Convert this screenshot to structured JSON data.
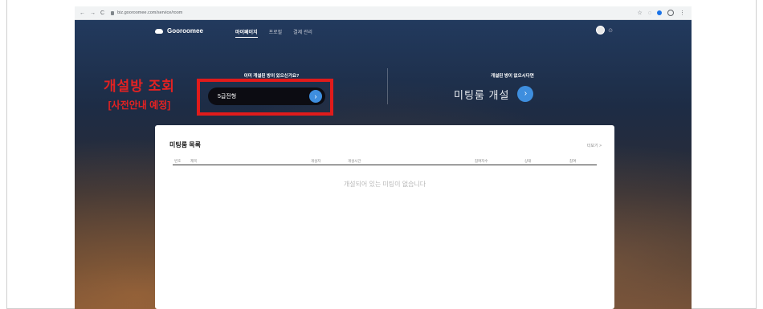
{
  "browser": {
    "nav": [
      "←",
      "→",
      "C"
    ],
    "url": "biz.gooroomee.com/service/room",
    "icons": [
      "star-icon",
      "extension-icon",
      "profile-icon",
      "menu-icon"
    ]
  },
  "header": {
    "brand": "Gooroomee",
    "menu": [
      "마이페이지",
      "프로필",
      "결제 관리"
    ]
  },
  "hero": {
    "left_question": "이미 개설된 방이 있으신가요?",
    "search_value": "5급전형",
    "right_question": "개설된 방이 없으시다면",
    "create_label": "미팅룸 개설"
  },
  "annotation": {
    "line1": "개설방 조회",
    "line2": "[사전안내 예정]"
  },
  "card": {
    "title": "미팅룸 목록",
    "more": "더보기 >",
    "columns": [
      "번호",
      "제목",
      "개설자",
      "개설시간",
      "참여자수",
      "상태",
      "참여"
    ],
    "empty_text": "개설되어 있는 미팅이 없습니다"
  },
  "colors": {
    "accent": "#3e8ede",
    "annotation_red": "#e01b1b"
  }
}
